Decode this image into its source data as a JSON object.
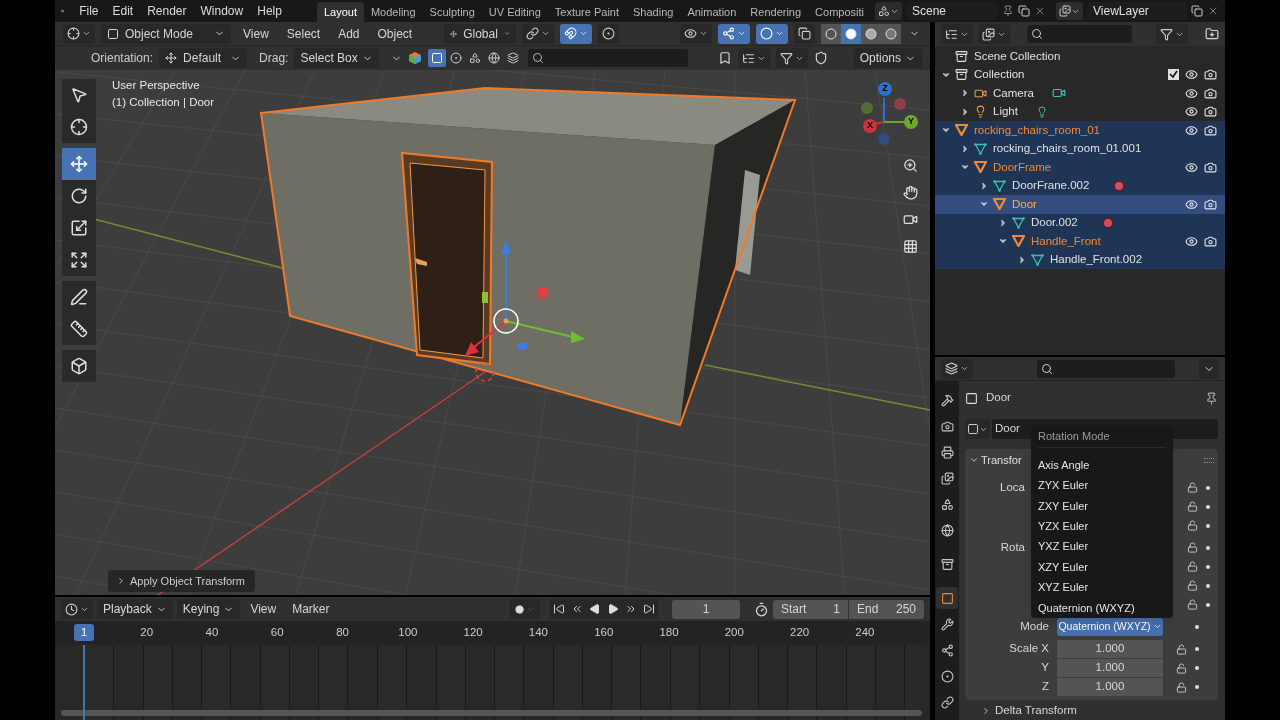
{
  "menubar": {
    "items": [
      "File",
      "Edit",
      "Render",
      "Window",
      "Help"
    ]
  },
  "workspaces": [
    {
      "label": "Layout",
      "selected": true
    },
    {
      "label": "Modeling",
      "selected": false
    },
    {
      "label": "Sculpting",
      "selected": false
    },
    {
      "label": "UV Editing",
      "selected": false
    },
    {
      "label": "Texture Paint",
      "selected": false
    },
    {
      "label": "Shading",
      "selected": false
    },
    {
      "label": "Animation",
      "selected": false
    },
    {
      "label": "Rendering",
      "selected": false
    },
    {
      "label": "Compositi",
      "selected": false
    }
  ],
  "scene": "Scene",
  "view_layer": "ViewLayer",
  "viewport_header": {
    "mode": "Object Mode",
    "menus": [
      "View",
      "Select",
      "Add",
      "Object"
    ],
    "orientation": "Global",
    "snap": true,
    "proportional": false,
    "gizmos": true,
    "overlays": true,
    "xray": false,
    "shading": [
      {
        "kind": "wireframe",
        "selected": false
      },
      {
        "kind": "solid",
        "selected": true
      },
      {
        "kind": "material",
        "selected": false
      },
      {
        "kind": "rendered",
        "selected": false
      }
    ]
  },
  "tool_settings": {
    "orientation_label": "Orientation:",
    "orientation": "Default",
    "drag_label": "Drag:",
    "drag": "Select Box",
    "options": "Options",
    "select_modes": [
      {
        "kind": "set",
        "selected": true
      },
      {
        "kind": "extend",
        "selected": false
      },
      {
        "kind": "subtract",
        "selected": false
      },
      {
        "kind": "difference",
        "selected": false
      },
      {
        "kind": "intersect",
        "selected": false
      }
    ]
  },
  "viewport": {
    "perspective": "User Perspective",
    "context": "(1) Collection | Door",
    "axes": [
      "Z",
      "Y",
      "X"
    ],
    "last_operation": "Apply Object Transform",
    "tool_groups": [
      [
        {
          "kind": "select_box",
          "selected": false
        },
        {
          "kind": "cursor",
          "selected": false
        }
      ],
      [
        {
          "kind": "move",
          "selected": true
        },
        {
          "kind": "rotate",
          "selected": false
        },
        {
          "kind": "scale",
          "selected": false
        },
        {
          "kind": "transform",
          "selected": false
        }
      ],
      [
        {
          "kind": "annotate",
          "selected": false
        },
        {
          "kind": "measure",
          "selected": false
        }
      ],
      [
        {
          "kind": "add_cube",
          "selected": false
        }
      ]
    ]
  },
  "timeline": {
    "menus": [
      "Playback",
      "Keying",
      "View",
      "Marker"
    ],
    "current_frame": "1",
    "start_label": "Start",
    "start": "1",
    "end_label": "End",
    "end": "250",
    "playhead": "1",
    "ruler": [
      "20",
      "40",
      "60",
      "80",
      "100",
      "120",
      "140",
      "160",
      "180",
      "200",
      "220",
      "240"
    ]
  },
  "outliner": {
    "root": {
      "name": "Scene Collection",
      "children": [
        {
          "kind": "collection",
          "name": "Collection",
          "expanded": true,
          "selected": false,
          "active": false,
          "children": [
            {
              "kind": "camera",
              "name": "Camera",
              "expanded": false,
              "selected": false,
              "active": false
            },
            {
              "kind": "light",
              "name": "Light",
              "expanded": false,
              "selected": false,
              "active": false
            }
          ]
        },
        {
          "kind": "object",
          "name": "rocking_chairs_room_01",
          "expanded": true,
          "selected": true,
          "active": false,
          "children": [
            {
              "kind": "mesh",
              "name": "rocking_chairs_room_01.001",
              "expanded": false,
              "selected": true,
              "active": false,
              "material": false
            },
            {
              "kind": "object",
              "name": "DoorFrame",
              "expanded": true,
              "selected": true,
              "active": false,
              "children": [
                {
                  "kind": "mesh",
                  "name": "DoorFrane.002",
                  "expanded": false,
                  "selected": true,
                  "active": false,
                  "material": true
                },
                {
                  "kind": "object",
                  "name": "Door",
                  "expanded": true,
                  "selected": true,
                  "active": true,
                  "children": [
                    {
                      "kind": "mesh",
                      "name": "Door.002",
                      "expanded": false,
                      "selected": true,
                      "active": false,
                      "material": true
                    },
                    {
                      "kind": "object",
                      "name": "Handle_Front",
                      "expanded": true,
                      "selected": true,
                      "active": false,
                      "children": [
                        {
                          "kind": "mesh",
                          "name": "Handle_Front.002",
                          "expanded": false,
                          "selected": true,
                          "active": false,
                          "material": false
                        }
                      ]
                    }
                  ]
                }
              ]
            }
          ]
        }
      ]
    }
  },
  "properties": {
    "tabs": [
      {
        "kind": "tool",
        "selected": false
      },
      {
        "kind": "render",
        "selected": false
      },
      {
        "kind": "output",
        "selected": false
      },
      {
        "kind": "view_layer",
        "selected": false
      },
      {
        "kind": "scene",
        "selected": false
      },
      {
        "kind": "world",
        "selected": false
      },
      {
        "kind": "collection",
        "selected": false
      },
      {
        "kind": "object",
        "selected": true
      },
      {
        "kind": "modifiers",
        "selected": false
      },
      {
        "kind": "particles",
        "selected": false
      },
      {
        "kind": "physics",
        "selected": false
      },
      {
        "kind": "constraints",
        "selected": false
      }
    ],
    "object_name": "Door",
    "data_name": "Door",
    "panel": "Transfor",
    "location": {
      "label": "Loca",
      "locks": [
        {
          "locked": false
        },
        {
          "locked": false
        },
        {
          "locked": false
        }
      ]
    },
    "rotation": {
      "label": "Rota",
      "locks": [
        {
          "locked": false
        },
        {
          "locked": false
        },
        {
          "locked": false
        },
        {
          "locked": false
        }
      ]
    },
    "mode_label": "Mode",
    "mode": "Quaternion (WXYZ)",
    "scale": [
      {
        "label": "Scale X",
        "value": "1.000",
        "locked": false
      },
      {
        "label": "Y",
        "value": "1.000",
        "locked": false
      },
      {
        "label": "Z",
        "value": "1.000",
        "locked": false
      }
    ],
    "delta": "Delta Transform",
    "menu": {
      "title": "Rotation Mode",
      "items": [
        "Axis Angle",
        "ZYX Euler",
        "ZXY Euler",
        "YZX Euler",
        "YXZ Euler",
        "XZY Euler",
        "XYZ Euler",
        "Quaternion (WXYZ)"
      ]
    }
  }
}
